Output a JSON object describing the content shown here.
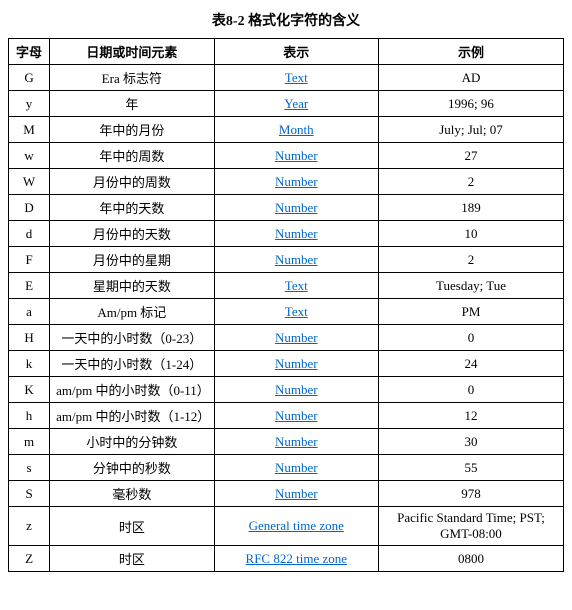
{
  "title": "表8-2 格式化字符的含义",
  "headers": [
    "字母",
    "日期或时间元素",
    "表示",
    "示例"
  ],
  "rows": [
    {
      "letter": "G",
      "element": "Era 标志符",
      "represent": "Text",
      "example": "AD",
      "represent_link": true
    },
    {
      "letter": "y",
      "element": "年",
      "represent": "Year",
      "example": "1996; 96",
      "represent_link": true
    },
    {
      "letter": "M",
      "element": "年中的月份",
      "represent": "Month",
      "example": "July; Jul; 07",
      "represent_link": true
    },
    {
      "letter": "w",
      "element": "年中的周数",
      "represent": "Number",
      "example": "27",
      "represent_link": true
    },
    {
      "letter": "W",
      "element": "月份中的周数",
      "represent": "Number",
      "example": "2",
      "represent_link": true
    },
    {
      "letter": "D",
      "element": "年中的天数",
      "represent": "Number",
      "example": "189",
      "represent_link": true
    },
    {
      "letter": "d",
      "element": "月份中的天数",
      "represent": "Number",
      "example": "10",
      "represent_link": true
    },
    {
      "letter": "F",
      "element": "月份中的星期",
      "represent": "Number",
      "example": "2",
      "represent_link": true
    },
    {
      "letter": "E",
      "element": "星期中的天数",
      "represent": "Text",
      "example": "Tuesday; Tue",
      "represent_link": true
    },
    {
      "letter": "a",
      "element": "Am/pm 标记",
      "represent": "Text",
      "example": "PM",
      "represent_link": true
    },
    {
      "letter": "H",
      "element": "一天中的小时数（0-23）",
      "represent": "Number",
      "example": "0",
      "represent_link": true
    },
    {
      "letter": "k",
      "element": "一天中的小时数（1-24）",
      "represent": "Number",
      "example": "24",
      "represent_link": true
    },
    {
      "letter": "K",
      "element": "am/pm 中的小时数（0-11）",
      "represent": "Number",
      "example": "0",
      "represent_link": true
    },
    {
      "letter": "h",
      "element": "am/pm 中的小时数（1-12）",
      "represent": "Number",
      "example": "12",
      "represent_link": true
    },
    {
      "letter": "m",
      "element": "小时中的分钟数",
      "represent": "Number",
      "example": "30",
      "represent_link": true
    },
    {
      "letter": "s",
      "element": "分钟中的秒数",
      "represent": "Number",
      "example": "55",
      "represent_link": true
    },
    {
      "letter": "S",
      "element": "毫秒数",
      "represent": "Number",
      "example": "978",
      "represent_link": true
    },
    {
      "letter": "z",
      "element": "时区",
      "represent": "General time zone",
      "example": "Pacific Standard Time; PST; GMT-08:00",
      "represent_link": true
    },
    {
      "letter": "Z",
      "element": "时区",
      "represent": "RFC 822 time zone",
      "example": "0800",
      "represent_link": true
    }
  ]
}
